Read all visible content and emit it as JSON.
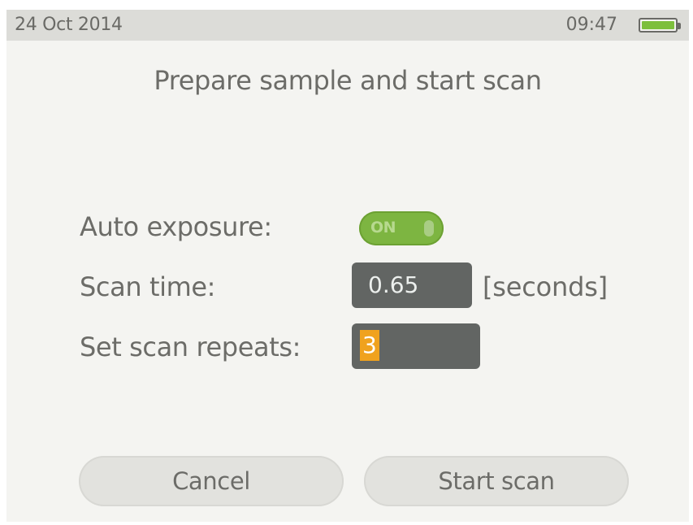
{
  "status_bar": {
    "date": "24 Oct 2014",
    "time": "09:47",
    "battery_icon": "battery-full-icon",
    "battery_level": 1.0,
    "battery_color": "#7dbf3c"
  },
  "screen": {
    "title": "Prepare sample and start scan"
  },
  "settings": {
    "auto_exposure": {
      "label": "Auto exposure:",
      "toggle_text": "ON",
      "state": "on",
      "color": "#7db541"
    },
    "scan_time": {
      "label": "Scan time:",
      "value": "0.65",
      "unit": "[seconds]"
    },
    "scan_repeats": {
      "label": "Set scan repeats:",
      "value": "3",
      "highlight_color": "#f0a21e"
    }
  },
  "buttons": {
    "cancel": "Cancel",
    "start": "Start scan"
  }
}
